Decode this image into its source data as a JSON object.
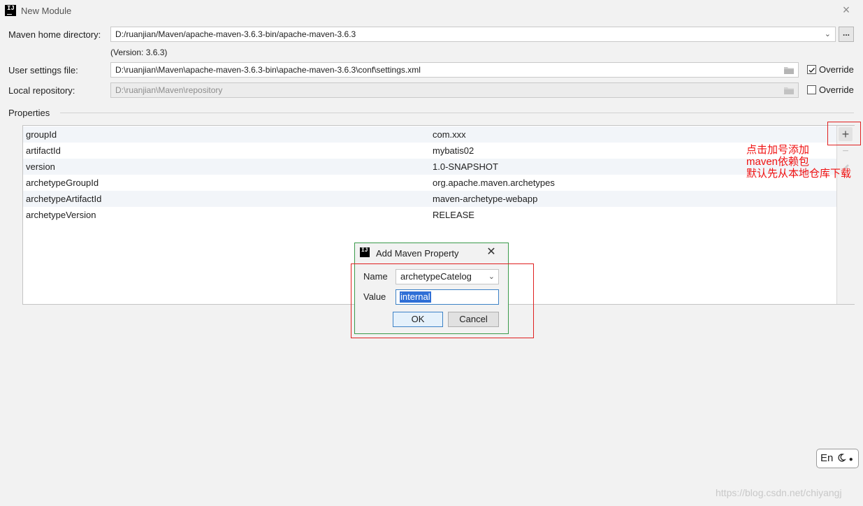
{
  "window": {
    "title": "New Module"
  },
  "maven_home": {
    "label": "Maven home directory:",
    "value": "D:/ruanjian/Maven/apache-maven-3.6.3-bin/apache-maven-3.6.3",
    "version": "(Version: 3.6.3)",
    "browse_label": "..."
  },
  "user_settings": {
    "label": "User settings file:",
    "value": "D:\\ruanjian\\Maven\\apache-maven-3.6.3-bin\\apache-maven-3.6.3\\conf\\settings.xml",
    "override_label": "Override",
    "override_checked": true
  },
  "local_repo": {
    "label": "Local repository:",
    "value": "D:\\ruanjian\\Maven\\repository",
    "override_label": "Override",
    "override_checked": false
  },
  "properties": {
    "section_label": "Properties",
    "rows": [
      {
        "key": "groupId",
        "value": "com.xxx"
      },
      {
        "key": "artifactId",
        "value": "mybatis02"
      },
      {
        "key": "version",
        "value": "1.0-SNAPSHOT"
      },
      {
        "key": "archetypeGroupId",
        "value": "org.apache.maven.archetypes"
      },
      {
        "key": "archetypeArtifactId",
        "value": "maven-archetype-webapp"
      },
      {
        "key": "archetypeVersion",
        "value": "RELEASE"
      }
    ],
    "add_icon": "+",
    "remove_icon": "−"
  },
  "annotation": {
    "lines": [
      "点击加号添加",
      "maven依赖包",
      "默认先从本地仓库下载"
    ],
    "color": "#f01010"
  },
  "dialog": {
    "title": "Add Maven Property",
    "close": "✕",
    "name_label": "Name",
    "name_value": "archetypeCatelog",
    "value_label": "Value",
    "value_value": "internal",
    "ok_label": "OK",
    "cancel_label": "Cancel"
  },
  "ime": {
    "text": "En"
  },
  "watermark": "https://blog.csdn.net/chiyangj"
}
